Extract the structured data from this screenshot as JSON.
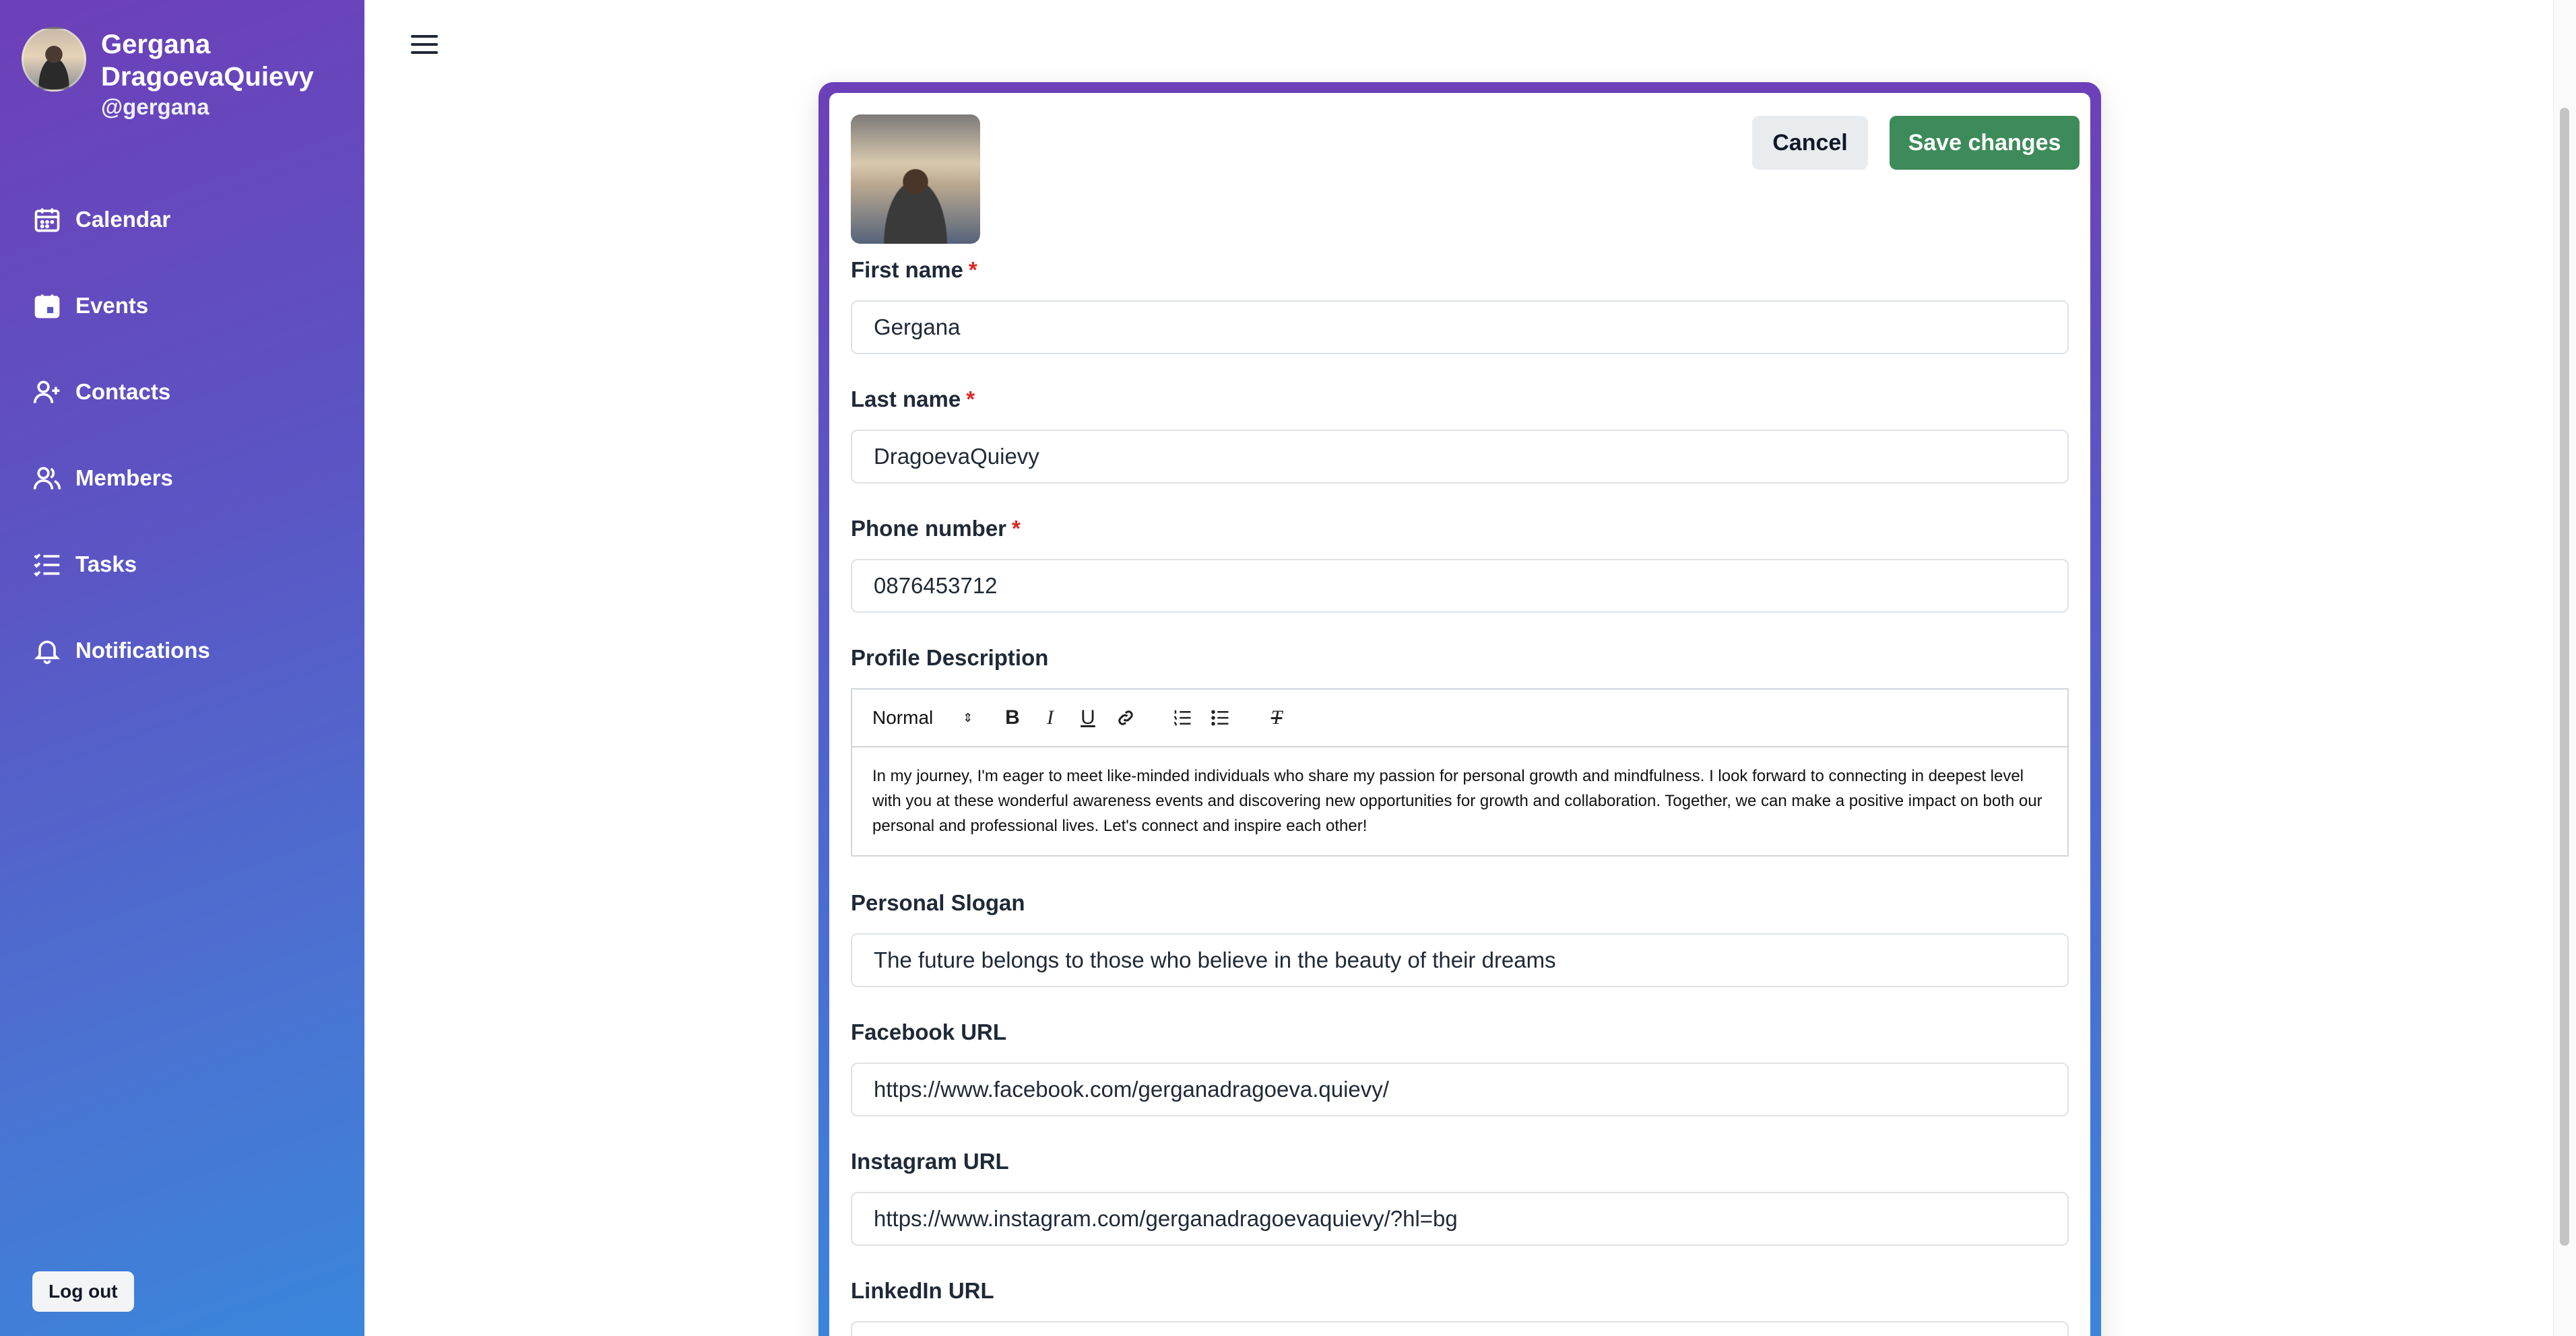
{
  "sidebar": {
    "user_name": "Gergana DragoevaQuievy",
    "user_handle": "@gergana",
    "nav": [
      {
        "label": "Calendar",
        "icon": "calendar-icon"
      },
      {
        "label": "Events",
        "icon": "event-icon"
      },
      {
        "label": "Contacts",
        "icon": "add-contact-icon"
      },
      {
        "label": "Members",
        "icon": "members-icon"
      },
      {
        "label": "Tasks",
        "icon": "tasks-icon"
      },
      {
        "label": "Notifications",
        "icon": "bell-icon"
      }
    ],
    "logout_label": "Log out"
  },
  "form": {
    "cancel_label": "Cancel",
    "save_label": "Save changes",
    "first_name": {
      "label": "First name",
      "required_mark": "*",
      "value": "Gergana"
    },
    "last_name": {
      "label": "Last name",
      "required_mark": "*",
      "value": "DragoevaQuievy"
    },
    "phone": {
      "label": "Phone number",
      "required_mark": "*",
      "value": "0876453712"
    },
    "description": {
      "label": "Profile Description",
      "format_select": "Normal",
      "text": "In my journey, I'm eager to meet like-minded individuals who share my passion for personal growth and mindfulness. I look forward to connecting in deepest level with you at these wonderful awareness events and discovering new opportunities for growth and collaboration. Together, we can make a positive impact on both our personal and professional lives. Let's connect and inspire each other!"
    },
    "slogan": {
      "label": "Personal Slogan",
      "value": "The future belongs to those who believe in the beauty of their dreams"
    },
    "facebook": {
      "label": "Facebook URL",
      "value": "https://www.facebook.com/gerganadragoeva.quievy/"
    },
    "instagram": {
      "label": "Instagram URL",
      "value": "https://www.instagram.com/gerganadragoevaquievy/?hl=bg"
    },
    "linkedin": {
      "label": "LinkedIn URL",
      "value": ""
    }
  },
  "colors": {
    "save_button": "#3d8b5a",
    "required_mark": "#dc2626",
    "sidebar_gradient_start": "#6d3fb8",
    "sidebar_gradient_end": "#3a86dc"
  }
}
